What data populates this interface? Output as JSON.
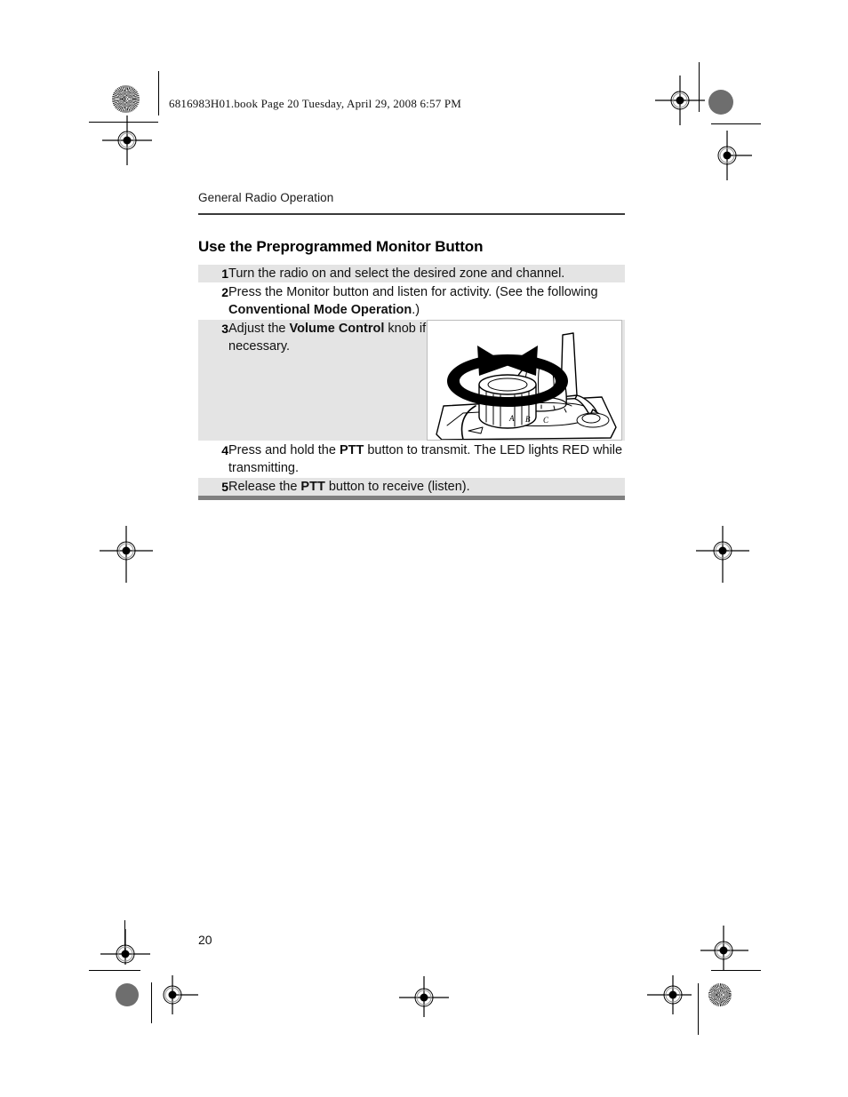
{
  "print_marks": {
    "slug_line": "6816983H01.book  Page 20  Tuesday, April 29, 2008  6:57 PM"
  },
  "page": {
    "running_head": "General Radio Operation",
    "section_title": "Use the Preprogrammed Monitor Button",
    "folio": "20"
  },
  "procedure": {
    "steps": [
      {
        "number": "1",
        "shaded": true,
        "segments": [
          {
            "text": "Turn the radio on and select the desired zone and channel.",
            "bold": false
          }
        ],
        "has_art": false
      },
      {
        "number": "2",
        "shaded": false,
        "segments": [
          {
            "text": "Press the Monitor button and listen for activity. (See the following ",
            "bold": false
          },
          {
            "text": "Conventional Mode Operation",
            "bold": true
          },
          {
            "text": ".)",
            "bold": false
          }
        ],
        "has_art": false
      },
      {
        "number": "3",
        "shaded": true,
        "segments": [
          {
            "text": "Adjust the ",
            "bold": false
          },
          {
            "text": "Volume Control",
            "bold": true
          },
          {
            "text": " knob if necessary.",
            "bold": false
          }
        ],
        "has_art": true,
        "art": {
          "name": "radio-volume-knob-illustration",
          "caption_labels": [
            "A",
            "B",
            "C"
          ]
        }
      },
      {
        "number": "4",
        "shaded": false,
        "segments": [
          {
            "text": "Press and hold the ",
            "bold": false
          },
          {
            "text": "PTT",
            "bold": true
          },
          {
            "text": " button to transmit. The LED lights RED while transmitting.",
            "bold": false
          }
        ],
        "has_art": false
      },
      {
        "number": "5",
        "shaded": true,
        "segments": [
          {
            "text": "Release the ",
            "bold": false
          },
          {
            "text": "PTT",
            "bold": true
          },
          {
            "text": " button to receive (listen).",
            "bold": false
          }
        ],
        "has_art": false
      }
    ]
  },
  "colors": {
    "row_shade": "#e4e4e4",
    "bottom_rule": "#808080",
    "head_rule": "#3a3a3a",
    "text": "#111111"
  }
}
